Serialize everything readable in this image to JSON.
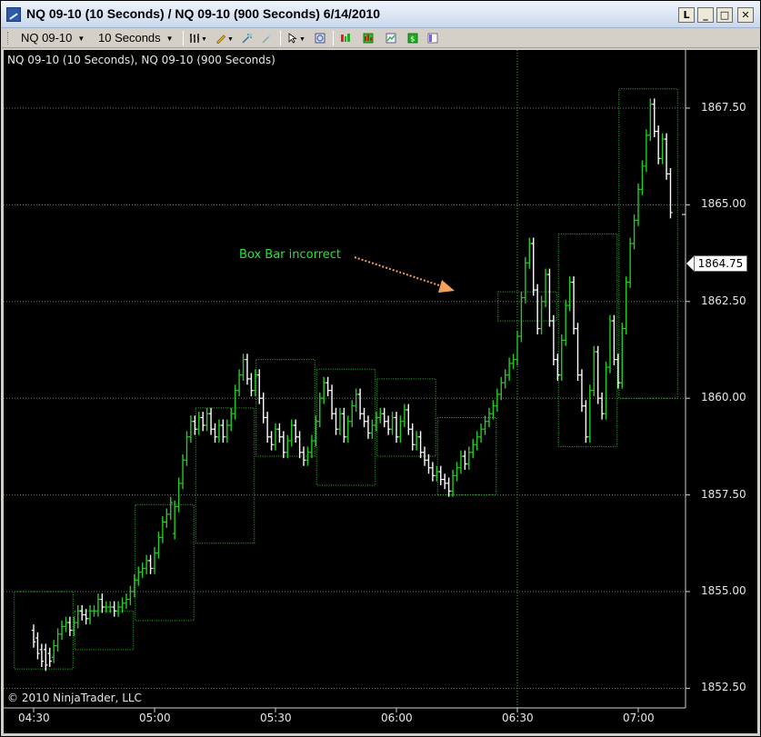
{
  "window": {
    "title": "NQ 09-10 (10 Seconds) / NQ 09-10 (900 Seconds)  6/14/2010",
    "buttons": {
      "l": "L",
      "minimize": "_",
      "maximize": "□",
      "close": "✕"
    }
  },
  "toolbar": {
    "instrument": "NQ 09-10",
    "period": "10 Seconds",
    "icons": [
      "bar-type-icon",
      "drawing-pencil-icon",
      "crosshair-icon",
      "zoom-tool-icon",
      "pointer-icon",
      "data-box-icon",
      "chart-trader-icon",
      "indicators-icon",
      "strategies-icon",
      "properties-icon",
      "zoom-icon"
    ]
  },
  "chart": {
    "title": "NQ 09-10 (10 Seconds), NQ 09-10 (900 Seconds)",
    "copyright": "© 2010 NinjaTrader, LLC",
    "annotation": "Box Bar incorrect",
    "last_price": "1864.75",
    "colors": {
      "background": "#000000",
      "up_bar": "#22cc22",
      "down_bar": "#ffffff",
      "box": "#2fbf2f",
      "annotation": "#1fe63a",
      "arrow": "#f2a05a",
      "grid": "#6f6f6f"
    }
  },
  "chart_data": {
    "type": "ohlc",
    "ylim": [
      1852.5,
      1868.0
    ],
    "yticks": [
      "1867.50",
      "1865.00",
      "1862.50",
      "1860.00",
      "1857.50",
      "1855.00",
      "1852.50"
    ],
    "xticks": [
      "04:30",
      "05:00",
      "05:30",
      "06:00",
      "06:30",
      "07:00"
    ],
    "x_domain": [
      "04:30",
      "07:00"
    ],
    "box_bars": [
      {
        "time": "04:30",
        "open": 1854.0,
        "high": 1855.0,
        "low": 1853.0,
        "close": 1853.5
      },
      {
        "time": "04:45",
        "open": 1853.5,
        "high": 1854.5,
        "low": 1853.5,
        "close": 1854.5
      },
      {
        "time": "05:00",
        "open": 1854.5,
        "high": 1857.25,
        "low": 1854.25,
        "close": 1857.25
      },
      {
        "time": "05:15",
        "open": 1857.25,
        "high": 1859.75,
        "low": 1856.25,
        "close": 1859.5
      },
      {
        "time": "05:30",
        "open": 1859.75,
        "high": 1861.0,
        "low": 1858.5,
        "close": 1860.0
      },
      {
        "time": "05:45",
        "open": 1860.75,
        "high": 1860.75,
        "low": 1857.75,
        "close": 1858.5
      },
      {
        "time": "06:00",
        "open": 1858.5,
        "high": 1860.5,
        "low": 1858.5,
        "close": 1859.75
      },
      {
        "time": "06:15",
        "open": 1859.5,
        "high": 1859.5,
        "low": 1857.5,
        "close": 1857.5
      },
      {
        "time": "06:30",
        "open": 1862.25,
        "high": 1862.75,
        "low": 1862.0,
        "close": 1862.0
      },
      {
        "time": "06:45",
        "open": 1858.75,
        "high": 1864.25,
        "low": 1858.75,
        "close": 1864.25
      },
      {
        "time": "07:00",
        "open": 1860.0,
        "high": 1868.0,
        "low": 1860.0,
        "close": 1868.0
      }
    ],
    "ticks": [
      [
        "04:30",
        1854.0,
        1853.7
      ],
      [
        "04:31",
        1853.8,
        1853.4
      ],
      [
        "04:32",
        1853.5,
        1853.2
      ],
      [
        "04:33",
        1853.5,
        1853.1
      ],
      [
        "04:34",
        1853.4,
        1853.2
      ],
      [
        "04:35",
        1853.3,
        1853.6
      ],
      [
        "04:36",
        1853.6,
        1853.9
      ],
      [
        "04:37",
        1853.9,
        1854.1
      ],
      [
        "04:38",
        1854.1,
        1854.2
      ],
      [
        "04:39",
        1854.2,
        1854.0
      ],
      [
        "04:40",
        1854.0,
        1854.2
      ],
      [
        "04:41",
        1854.2,
        1854.5
      ],
      [
        "04:42",
        1854.5,
        1854.4
      ],
      [
        "04:43",
        1854.4,
        1854.3
      ],
      [
        "04:44",
        1854.3,
        1854.5
      ],
      [
        "04:45",
        1854.5,
        1854.5
      ],
      [
        "04:46",
        1854.5,
        1854.8
      ],
      [
        "04:47",
        1854.8,
        1854.6
      ],
      [
        "04:48",
        1854.6,
        1854.6
      ],
      [
        "04:49",
        1854.6,
        1854.6
      ],
      [
        "04:50",
        1854.6,
        1854.5
      ],
      [
        "04:51",
        1854.5,
        1854.6
      ],
      [
        "04:52",
        1854.6,
        1854.7
      ],
      [
        "04:53",
        1854.7,
        1854.8
      ],
      [
        "04:54",
        1854.8,
        1855.0
      ],
      [
        "04:55",
        1855.0,
        1855.3
      ],
      [
        "04:56",
        1855.3,
        1855.5
      ],
      [
        "04:57",
        1855.5,
        1855.6
      ],
      [
        "04:58",
        1855.6,
        1855.8
      ],
      [
        "04:59",
        1855.8,
        1855.6
      ],
      [
        "05:00",
        1855.6,
        1856.0
      ],
      [
        "05:01",
        1856.0,
        1856.4
      ],
      [
        "05:02",
        1856.4,
        1856.8
      ],
      [
        "05:03",
        1856.8,
        1857.0
      ],
      [
        "05:04",
        1857.0,
        1857.3
      ],
      [
        "05:05",
        1856.5,
        1857.2
      ],
      [
        "05:06",
        1857.2,
        1857.8
      ],
      [
        "05:07",
        1857.8,
        1858.4
      ],
      [
        "05:08",
        1858.4,
        1859.0
      ],
      [
        "05:09",
        1859.0,
        1859.4
      ],
      [
        "05:10",
        1859.4,
        1859.2
      ],
      [
        "05:11",
        1859.2,
        1859.5
      ],
      [
        "05:12",
        1859.5,
        1859.3
      ],
      [
        "05:13",
        1859.3,
        1859.6
      ],
      [
        "05:14",
        1859.6,
        1859.2
      ],
      [
        "05:15",
        1859.2,
        1859.0
      ],
      [
        "05:16",
        1859.0,
        1859.3
      ],
      [
        "05:17",
        1859.3,
        1859.0
      ],
      [
        "05:18",
        1859.0,
        1859.3
      ],
      [
        "05:19",
        1859.3,
        1859.6
      ],
      [
        "05:20",
        1859.6,
        1860.2
      ],
      [
        "05:21",
        1860.2,
        1860.6
      ],
      [
        "05:22",
        1860.6,
        1861.0
      ],
      [
        "05:23",
        1861.0,
        1860.5
      ],
      [
        "05:24",
        1860.5,
        1860.2
      ],
      [
        "05:25",
        1860.2,
        1860.6
      ],
      [
        "05:26",
        1860.6,
        1860.0
      ],
      [
        "05:27",
        1860.0,
        1859.5
      ],
      [
        "05:28",
        1859.5,
        1859.0
      ],
      [
        "05:29",
        1859.0,
        1858.8
      ],
      [
        "05:30",
        1858.8,
        1859.2
      ],
      [
        "05:31",
        1859.2,
        1859.0
      ],
      [
        "05:32",
        1859.0,
        1858.6
      ],
      [
        "05:33",
        1858.6,
        1858.9
      ],
      [
        "05:34",
        1858.9,
        1859.3
      ],
      [
        "05:35",
        1859.3,
        1859.0
      ],
      [
        "05:36",
        1859.0,
        1858.6
      ],
      [
        "05:37",
        1858.6,
        1858.4
      ],
      [
        "05:38",
        1858.4,
        1858.6
      ],
      [
        "05:39",
        1858.6,
        1858.9
      ],
      [
        "05:40",
        1858.9,
        1859.4
      ],
      [
        "05:41",
        1859.4,
        1860.0
      ],
      [
        "05:42",
        1860.0,
        1860.4
      ],
      [
        "05:43",
        1860.4,
        1860.2
      ],
      [
        "05:44",
        1860.2,
        1859.6
      ],
      [
        "05:45",
        1859.6,
        1859.2
      ],
      [
        "05:46",
        1859.2,
        1859.6
      ],
      [
        "05:47",
        1859.6,
        1859.0
      ],
      [
        "05:48",
        1859.0,
        1859.4
      ],
      [
        "05:49",
        1859.4,
        1859.8
      ],
      [
        "05:50",
        1859.8,
        1860.1
      ],
      [
        "05:51",
        1860.1,
        1859.6
      ],
      [
        "05:52",
        1859.6,
        1859.4
      ],
      [
        "05:53",
        1859.4,
        1859.1
      ],
      [
        "05:54",
        1859.1,
        1859.3
      ],
      [
        "05:55",
        1859.3,
        1859.5
      ],
      [
        "05:56",
        1859.5,
        1859.6
      ],
      [
        "05:57",
        1859.6,
        1859.4
      ],
      [
        "05:58",
        1859.4,
        1859.2
      ],
      [
        "05:59",
        1859.2,
        1859.5
      ],
      [
        "06:00",
        1859.5,
        1859.0
      ],
      [
        "06:01",
        1859.0,
        1859.4
      ],
      [
        "06:02",
        1859.4,
        1859.7
      ],
      [
        "06:03",
        1859.7,
        1859.2
      ],
      [
        "06:04",
        1859.2,
        1858.8
      ],
      [
        "06:05",
        1858.8,
        1859.0
      ],
      [
        "06:06",
        1859.0,
        1858.6
      ],
      [
        "06:07",
        1858.6,
        1858.4
      ],
      [
        "06:08",
        1858.4,
        1858.2
      ],
      [
        "06:09",
        1858.2,
        1858.0
      ],
      [
        "06:10",
        1858.0,
        1858.1
      ],
      [
        "06:11",
        1858.1,
        1857.9
      ],
      [
        "06:12",
        1857.9,
        1857.8
      ],
      [
        "06:13",
        1857.8,
        1857.6
      ],
      [
        "06:14",
        1857.6,
        1858.0
      ],
      [
        "06:15",
        1858.0,
        1858.2
      ],
      [
        "06:16",
        1858.2,
        1858.5
      ],
      [
        "06:17",
        1858.5,
        1858.3
      ],
      [
        "06:18",
        1858.3,
        1858.6
      ],
      [
        "06:19",
        1858.6,
        1858.8
      ],
      [
        "06:20",
        1858.8,
        1859.0
      ],
      [
        "06:21",
        1859.0,
        1859.2
      ],
      [
        "06:22",
        1859.2,
        1859.4
      ],
      [
        "06:23",
        1859.4,
        1859.6
      ],
      [
        "06:24",
        1859.6,
        1859.8
      ],
      [
        "06:25",
        1859.8,
        1860.1
      ],
      [
        "06:26",
        1860.1,
        1860.4
      ],
      [
        "06:27",
        1860.4,
        1860.6
      ],
      [
        "06:28",
        1860.6,
        1860.9
      ],
      [
        "06:29",
        1860.9,
        1861.0
      ],
      [
        "06:30",
        1861.0,
        1861.6
      ],
      [
        "06:31",
        1861.6,
        1862.6
      ],
      [
        "06:32",
        1862.6,
        1863.5
      ],
      [
        "06:33",
        1863.5,
        1864.0
      ],
      [
        "06:34",
        1864.0,
        1862.8
      ],
      [
        "06:35",
        1862.8,
        1861.8
      ],
      [
        "06:36",
        1861.8,
        1862.5
      ],
      [
        "06:37",
        1862.5,
        1863.2
      ],
      [
        "06:38",
        1863.2,
        1862.0
      ],
      [
        "06:39",
        1862.0,
        1861.0
      ],
      [
        "06:40",
        1861.0,
        1860.6
      ],
      [
        "06:41",
        1860.6,
        1861.5
      ],
      [
        "06:42",
        1861.5,
        1862.4
      ],
      [
        "06:43",
        1862.4,
        1863.0
      ],
      [
        "06:44",
        1863.0,
        1861.8
      ],
      [
        "06:45",
        1861.8,
        1860.6
      ],
      [
        "06:46",
        1860.6,
        1859.8
      ],
      [
        "06:47",
        1859.8,
        1859.0
      ],
      [
        "06:48",
        1859.0,
        1860.2
      ],
      [
        "06:49",
        1860.2,
        1861.2
      ],
      [
        "06:50",
        1861.2,
        1860.0
      ],
      [
        "06:51",
        1860.0,
        1859.6
      ],
      [
        "06:52",
        1859.6,
        1860.8
      ],
      [
        "06:53",
        1860.8,
        1862.0
      ],
      [
        "06:54",
        1862.0,
        1861.0
      ],
      [
        "06:55",
        1861.0,
        1860.4
      ],
      [
        "06:56",
        1860.4,
        1861.8
      ],
      [
        "06:57",
        1861.8,
        1863.0
      ],
      [
        "06:58",
        1863.0,
        1864.0
      ],
      [
        "06:59",
        1864.0,
        1864.6
      ],
      [
        "07:00",
        1864.6,
        1865.4
      ],
      [
        "07:01",
        1865.4,
        1866.0
      ],
      [
        "07:02",
        1866.0,
        1866.8
      ],
      [
        "07:03",
        1866.8,
        1867.6
      ],
      [
        "07:04",
        1867.6,
        1866.9
      ],
      [
        "07:05",
        1866.9,
        1866.2
      ],
      [
        "07:06",
        1866.2,
        1866.7
      ],
      [
        "07:07",
        1866.7,
        1865.8
      ],
      [
        "07:08",
        1865.8,
        1864.8
      ]
    ]
  }
}
